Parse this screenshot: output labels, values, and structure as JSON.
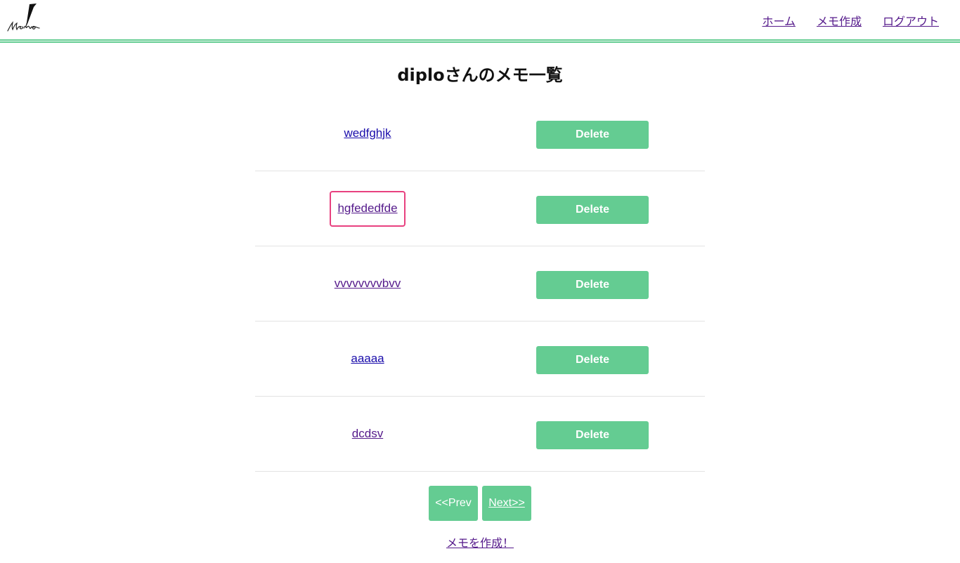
{
  "header": {
    "logo_text": "Memo",
    "nav": [
      {
        "label": "ホーム"
      },
      {
        "label": "メモ作成"
      },
      {
        "label": "ログアウト"
      }
    ]
  },
  "page_title": "diploさんのメモ一覧",
  "memos": [
    {
      "title": "wedfghjk",
      "delete_label": "Delete"
    },
    {
      "title": "hgfededfde",
      "delete_label": "Delete"
    },
    {
      "title": "vvvvvvvvbvv",
      "delete_label": "Delete"
    },
    {
      "title": "aaaaa",
      "delete_label": "Delete"
    },
    {
      "title": "dcdsv",
      "delete_label": "Delete"
    }
  ],
  "pager": {
    "prev_label": "<<Prev",
    "next_label": "Next>>"
  },
  "create_link": "メモを作成！",
  "colors": {
    "accent": "#64cc92",
    "highlight": "#e8417f",
    "link": "#1a0dab",
    "visited": "#551a8b"
  }
}
